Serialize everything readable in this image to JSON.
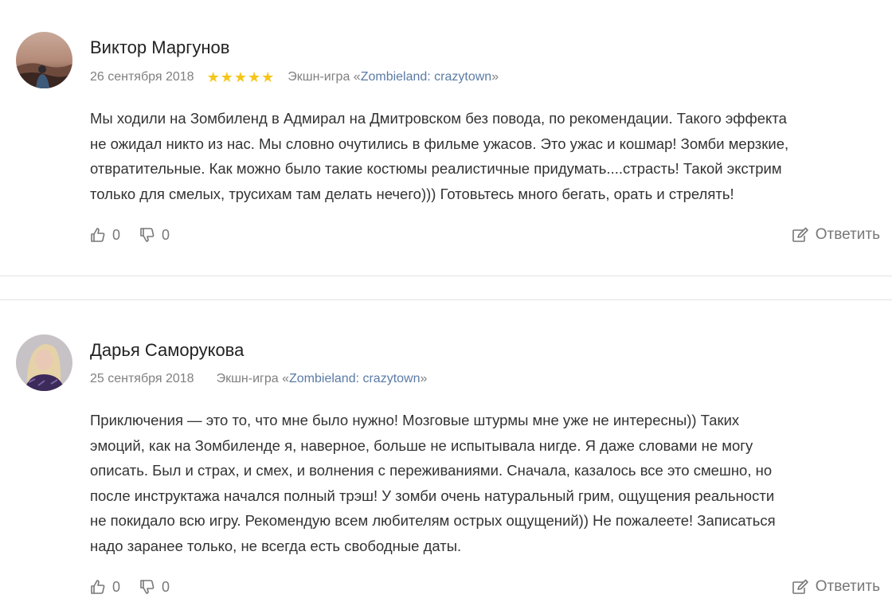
{
  "reviews": [
    {
      "author": "Виктор Маргунов",
      "date": "26 сентября 2018",
      "rating": 5,
      "game_label": "Экшн-игра «",
      "game_link": "Zombieland: crazytown",
      "game_close": "»",
      "text_lines": [
        "Мы ходили на Зомбиленд в Адмирал на Дмитровском без повода, по рекомендации. Такого эффекта",
        "не ожидал никто из нас. Мы словно очутились в фильме ужасов. Это ужас и кошмар! Зомби мерзкие,",
        "отвратительные. Как можно было такие костюмы реалистичные придумать....страсть! Такой экстрим",
        "только для смелых, трусихам там делать нечего))) Готовьтесь много бегать, орать и стрелять!"
      ],
      "likes": "0",
      "dislikes": "0",
      "reply_label": "Ответить"
    },
    {
      "author": "Дарья Саморукова",
      "date": "25 сентября 2018",
      "game_label": "Экшн-игра «",
      "game_link": "Zombieland: crazytown",
      "game_close": "»",
      "text_lines": [
        "Приключения — это то, что мне было нужно! Мозговые штурмы мне уже не интересны)) Таких",
        "эмоций, как на Зомбиленде я, наверное, больше не испытывала нигде. Я даже словами не могу",
        "описать. Был и страх, и смех, и волнения с переживаниями. Сначала, казалось все это смешно, но",
        "после инструктажа начался полный трэш! У зомби очень натуральный грим, ощущения реальности",
        "не покидало всю игру. Рекомендую всем любителям острых ощущений)) Не пожалеете! Записаться",
        "надо заранее только, не всегда есть свободные даты."
      ],
      "likes": "0",
      "dislikes": "0",
      "reply_label": "Ответить"
    }
  ],
  "colors": {
    "star": "#f5c518",
    "link": "#5b7ba5",
    "meta": "#808080",
    "separator": "#e4e4e4"
  }
}
